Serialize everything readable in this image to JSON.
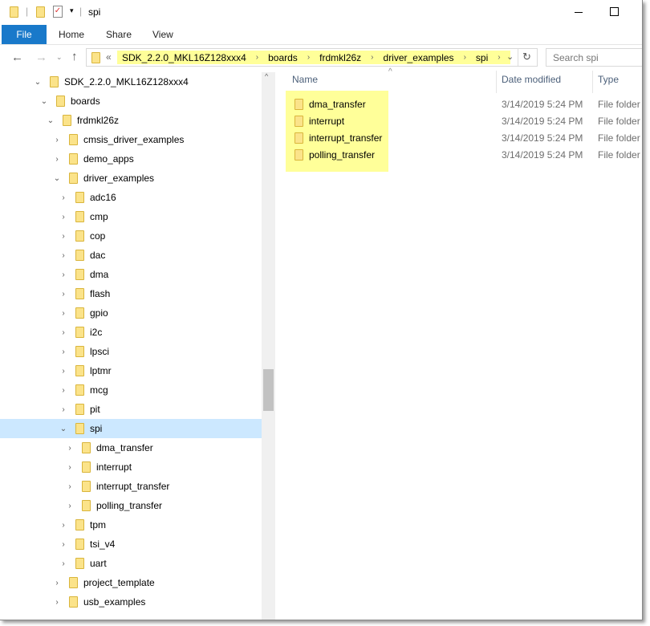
{
  "window": {
    "title": "spi",
    "minimize_icon": "minimize-icon",
    "maximize_icon": "maximize-icon"
  },
  "ribbon": {
    "tabs": [
      "File",
      "Home",
      "Share",
      "View"
    ]
  },
  "address": {
    "overflow": "«",
    "crumbs": [
      "SDK_2.2.0_MKL16Z128xxx4",
      "boards",
      "frdmkl26z",
      "driver_examples",
      "spi"
    ]
  },
  "search": {
    "placeholder": "Search spi"
  },
  "columns": {
    "name": "Name",
    "date": "Date modified",
    "type": "Type"
  },
  "highlight_color": "#ffff99",
  "files": [
    {
      "name": "dma_transfer",
      "date": "3/14/2019 5:24 PM",
      "type": "File folder"
    },
    {
      "name": "interrupt",
      "date": "3/14/2019 5:24 PM",
      "type": "File folder"
    },
    {
      "name": "interrupt_transfer",
      "date": "3/14/2019 5:24 PM",
      "type": "File folder"
    },
    {
      "name": "polling_transfer",
      "date": "3/14/2019 5:24 PM",
      "type": "File folder"
    }
  ],
  "tree": [
    {
      "label": "SDK_2.2.0_MKL16Z128xxx4",
      "level": 0,
      "expanded": true
    },
    {
      "label": "boards",
      "level": 1,
      "expanded": true
    },
    {
      "label": "frdmkl26z",
      "level": 2,
      "expanded": true
    },
    {
      "label": "cmsis_driver_examples",
      "level": 3
    },
    {
      "label": "demo_apps",
      "level": 3
    },
    {
      "label": "driver_examples",
      "level": 3,
      "expanded": true
    },
    {
      "label": "adc16",
      "level": 4
    },
    {
      "label": "cmp",
      "level": 4
    },
    {
      "label": "cop",
      "level": 4
    },
    {
      "label": "dac",
      "level": 4
    },
    {
      "label": "dma",
      "level": 4
    },
    {
      "label": "flash",
      "level": 4
    },
    {
      "label": "gpio",
      "level": 4
    },
    {
      "label": "i2c",
      "level": 4
    },
    {
      "label": "lpsci",
      "level": 4
    },
    {
      "label": "lptmr",
      "level": 4
    },
    {
      "label": "mcg",
      "level": 4
    },
    {
      "label": "pit",
      "level": 4
    },
    {
      "label": "spi",
      "level": 4,
      "expanded": true,
      "selected": true
    },
    {
      "label": "dma_transfer",
      "level": 5
    },
    {
      "label": "interrupt",
      "level": 5
    },
    {
      "label": "interrupt_transfer",
      "level": 5
    },
    {
      "label": "polling_transfer",
      "level": 5
    },
    {
      "label": "tpm",
      "level": 4
    },
    {
      "label": "tsi_v4",
      "level": 4
    },
    {
      "label": "uart",
      "level": 4
    },
    {
      "label": "project_template",
      "level": 3
    },
    {
      "label": "usb_examples",
      "level": 3
    }
  ]
}
